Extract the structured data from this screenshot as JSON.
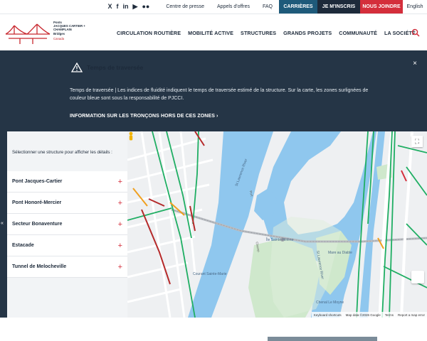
{
  "topbar": {
    "social": [
      "X",
      "f",
      "in",
      "▶",
      "●●"
    ],
    "links": [
      "Centre de presse",
      "Appels d'offres",
      "FAQ"
    ],
    "careers": "CARRIÈRES",
    "signup": "JE M'INSCRIS",
    "join": "NOUS JOINDRE",
    "lang": "English"
  },
  "logo": {
    "lines": [
      "Ponts",
      "JACQUES CARTIER +",
      "CHAMPLAIN",
      "Bridges"
    ],
    "sub": "Canada"
  },
  "nav": [
    "CIRCULATION ROUTIÈRE",
    "MOBILITÉ ACTIVE",
    "STRUCTURES",
    "GRANDS PROJETS",
    "COMMUNAUTÉ",
    "LA SOCIÉTÉ"
  ],
  "banner": {
    "title": "Temps de traversée",
    "text": "Temps de traversée | Les indices de fluidité indiquent le temps de traversée estimé de la structure. Sur la carte, les zones surlignées de couleur bleue sont sous la responsabilité de PJCCI.",
    "link": "INFORMATION SUR LES TRONÇONS HORS DE CES ZONES",
    "close": "×"
  },
  "panel": {
    "intro": "Sélectionner une structure pour afficher les détails :",
    "items": [
      "Pont Jacques-Cartier",
      "Pont Honoré-Mercier",
      "Secteur Bonaventure",
      "Estacade",
      "Tunnel de Melocheville"
    ],
    "plus": "+",
    "collapse": "«"
  },
  "map": {
    "labels": {
      "river1": "St Lawrence River",
      "river2": "St Lawrence River",
      "current": "Courant Sainte-Marie",
      "island": "Île Sainte-Hélène",
      "mare": "Mare au Diable",
      "chenal": "Chenal Le Moyne",
      "port": "Port",
      "champ": "Champ"
    },
    "attribution": [
      "Keyboard shortcuts",
      "Map data ©2026 Google",
      "Terms",
      "Report a map error"
    ],
    "fullscreen": "⛶"
  },
  "colors": {
    "navy": "#253546",
    "red": "#d42e3b",
    "teal": "#1e5a7a",
    "water": "#8fc7ee",
    "traffic_green": "#1fae63",
    "traffic_red": "#b52a2a",
    "traffic_orange": "#f0a020"
  }
}
